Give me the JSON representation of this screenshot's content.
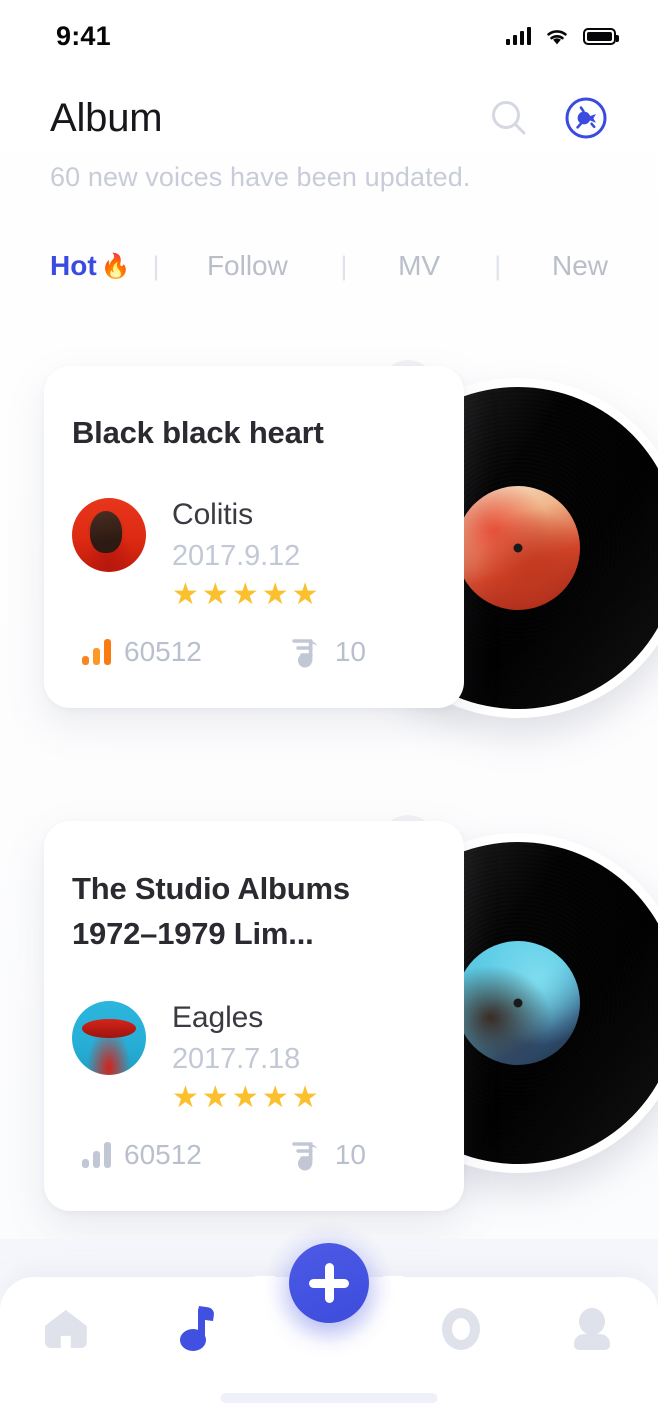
{
  "status_bar": {
    "time": "9:41",
    "signal_icon": "signal-bars-icon",
    "wifi_icon": "wifi-icon",
    "battery_icon": "battery-full-icon"
  },
  "header": {
    "title": "Album",
    "subtitle": "60 new voices have been updated.",
    "search_icon": "search-icon",
    "radio_icon": "vinyl-radio-icon"
  },
  "tabs": {
    "separator": "|",
    "items": [
      {
        "label": "Hot",
        "emoji": "🔥",
        "active": true
      },
      {
        "label": "Follow",
        "active": false
      },
      {
        "label": "MV",
        "active": false
      },
      {
        "label": "New",
        "active": false
      }
    ]
  },
  "albums": [
    {
      "title": "Black black heart",
      "artist": "Colitis",
      "date": "2017.9.12",
      "rating": 5,
      "star_glyph": "★",
      "plays_icon": "bar-chart-icon",
      "plays": "60512",
      "plays_highlight": true,
      "tracks_icon": "playlist-note-icon",
      "tracks": "10",
      "avatar_name": "artist-avatar-red",
      "record_label_name": "vinyl-label-red"
    },
    {
      "title": "The Studio Albums 1972–1979 Lim...",
      "artist": "Eagles",
      "date": "2017.7.18",
      "rating": 5,
      "star_glyph": "★",
      "plays_icon": "bar-chart-icon",
      "plays": "60512",
      "plays_highlight": false,
      "tracks_icon": "playlist-note-icon",
      "tracks": "10",
      "avatar_name": "artist-avatar-cyan",
      "record_label_name": "vinyl-label-cyan"
    }
  ],
  "bottom_nav": {
    "items": [
      {
        "name": "home-icon",
        "active": false
      },
      {
        "name": "music-note-icon",
        "active": true
      },
      {
        "name": "circle-icon",
        "active": false
      },
      {
        "name": "profile-icon",
        "active": false
      }
    ],
    "fab_icon": "plus-icon"
  },
  "colors": {
    "accent": "#4150E0",
    "star": "#FBC02D",
    "hot_bar": "#F9861F",
    "muted": "#c3c8d6",
    "title": "#2a2a30"
  }
}
